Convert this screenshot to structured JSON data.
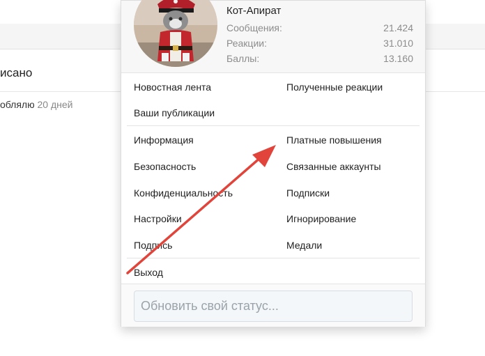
{
  "background": {
    "heading_fragment": "исано",
    "meta_text": "облялю",
    "meta_time": "20 дней"
  },
  "user": {
    "name": "Кот-Апират",
    "avatar_icon": "cat-pirate-avatar"
  },
  "stats": [
    {
      "label": "Сообщения:",
      "value": "21.424"
    },
    {
      "label": "Реакции:",
      "value": "31.010"
    },
    {
      "label": "Баллы:",
      "value": "13.160"
    }
  ],
  "menu": {
    "news_feed": "Новостная лента",
    "received_reactions": "Полученные реакции",
    "your_posts": "Ваши публикации",
    "information": "Информация",
    "paid_upgrades": "Платные повышения",
    "security": "Безопасность",
    "linked_accounts": "Связанные аккаунты",
    "privacy": "Конфиденциальность",
    "subscriptions": "Подписки",
    "settings": "Настройки",
    "ignoring": "Игнорирование",
    "signature": "Подпись",
    "medals": "Медали",
    "logout": "Выход"
  },
  "status": {
    "placeholder": "Обновить свой статус..."
  },
  "annotation": {
    "color": "#e0443a"
  }
}
